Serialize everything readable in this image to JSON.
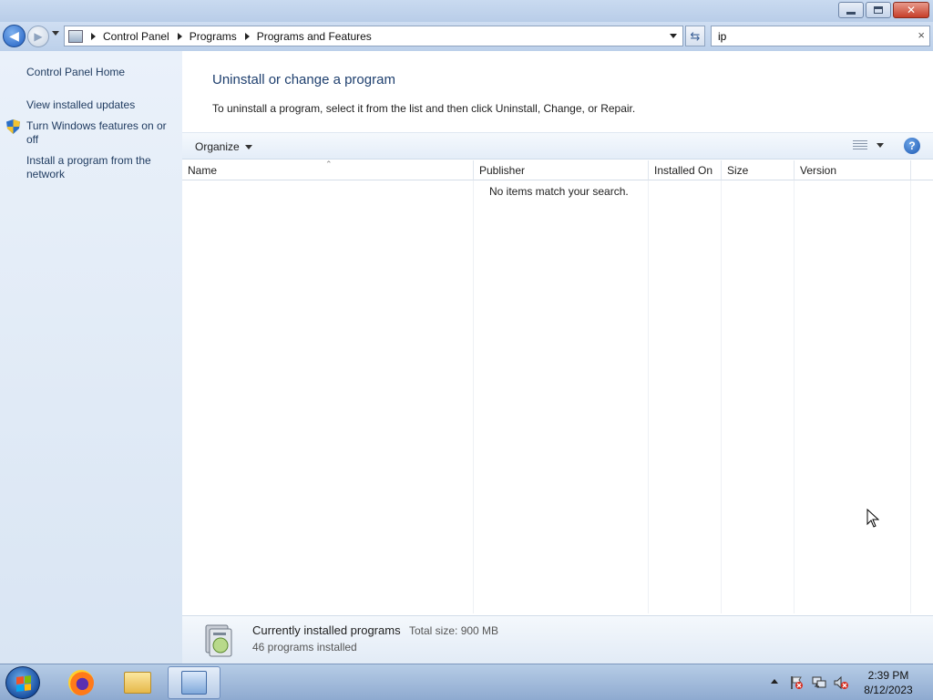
{
  "window": {
    "minimize_icon": "minimize-icon",
    "restore_icon": "restore-icon",
    "close_icon": "close-icon"
  },
  "navigation": {
    "back_icon": "back-arrow-icon",
    "forward_icon": "forward-arrow-icon",
    "breadcrumb": [
      "Control Panel",
      "Programs",
      "Programs and Features"
    ],
    "refresh_icon": "refresh-icon",
    "search_value": "ip",
    "search_clear_glyph": "×"
  },
  "sidebar": {
    "links": [
      "Control Panel Home",
      "View installed updates",
      "Turn Windows features on or off",
      "Install a program from the network"
    ]
  },
  "main": {
    "title": "Uninstall or change a program",
    "instructions": "To uninstall a program, select it from the list and then click Uninstall, Change, or Repair.",
    "organize_label": "Organize",
    "columns": [
      "Name",
      "Publisher",
      "Installed On",
      "Size",
      "Version"
    ],
    "empty_message": "No items match your search."
  },
  "details": {
    "title": "Currently installed programs",
    "total_size": "Total size: 900 MB",
    "count": "46 programs installed"
  },
  "taskbar": {
    "apps": [
      "firefox",
      "windows-explorer",
      "control-panel"
    ],
    "active_app": "control-panel",
    "time": "2:39 PM",
    "date": "8/12/2023"
  },
  "colors": {
    "heading": "#1e3f6e",
    "link": "#1e3a5f",
    "close_button": "#c63f2a",
    "start_orb": "#1a4fa0"
  }
}
